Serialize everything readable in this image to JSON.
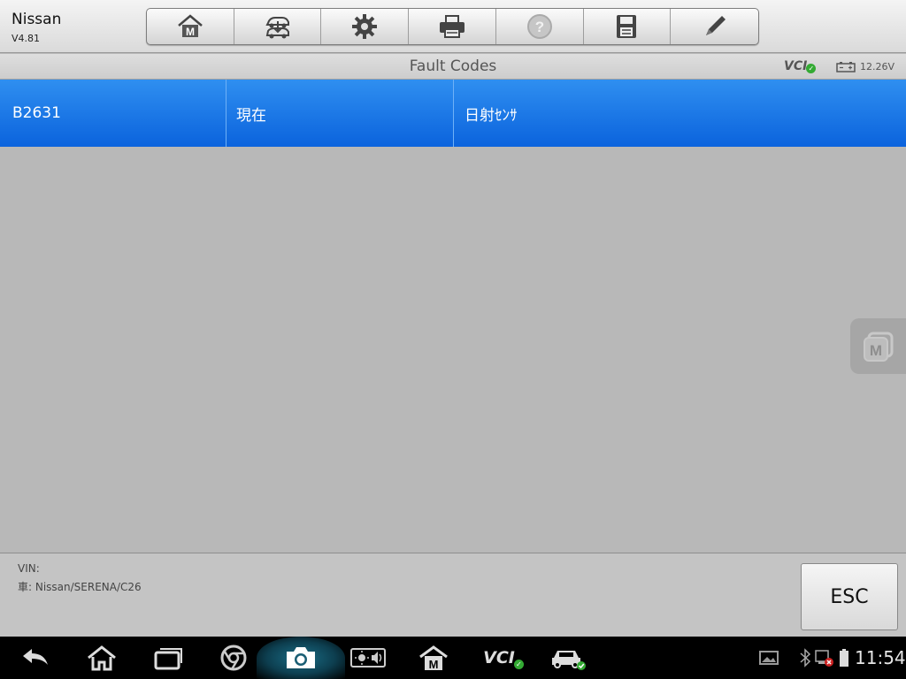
{
  "app": {
    "name": "Nissan",
    "version": "V4.81"
  },
  "toolbar": {
    "buttons": [
      {
        "icon": "home-icon"
      },
      {
        "icon": "vehicle-swap-icon"
      },
      {
        "icon": "settings-gear-icon"
      },
      {
        "icon": "print-icon"
      },
      {
        "icon": "help-icon"
      },
      {
        "icon": "save-icon"
      },
      {
        "icon": "edit-pencil-icon"
      }
    ]
  },
  "titlebar": {
    "title": "Fault Codes",
    "vci_label": "VCI",
    "voltage": "12.26V"
  },
  "fault_codes": [
    {
      "code": "B2631",
      "status": "現在",
      "description": "日射ｾﾝｻ"
    }
  ],
  "footer": {
    "vin": "VIN:",
    "car": "車: Nissan/SERENA/C26",
    "esc_label": "ESC"
  },
  "sysbar": {
    "vci_label": "VCI",
    "time": "11:54"
  },
  "colors": {
    "row_blue": "#1a74e8",
    "accent_check": "#33aa33"
  }
}
